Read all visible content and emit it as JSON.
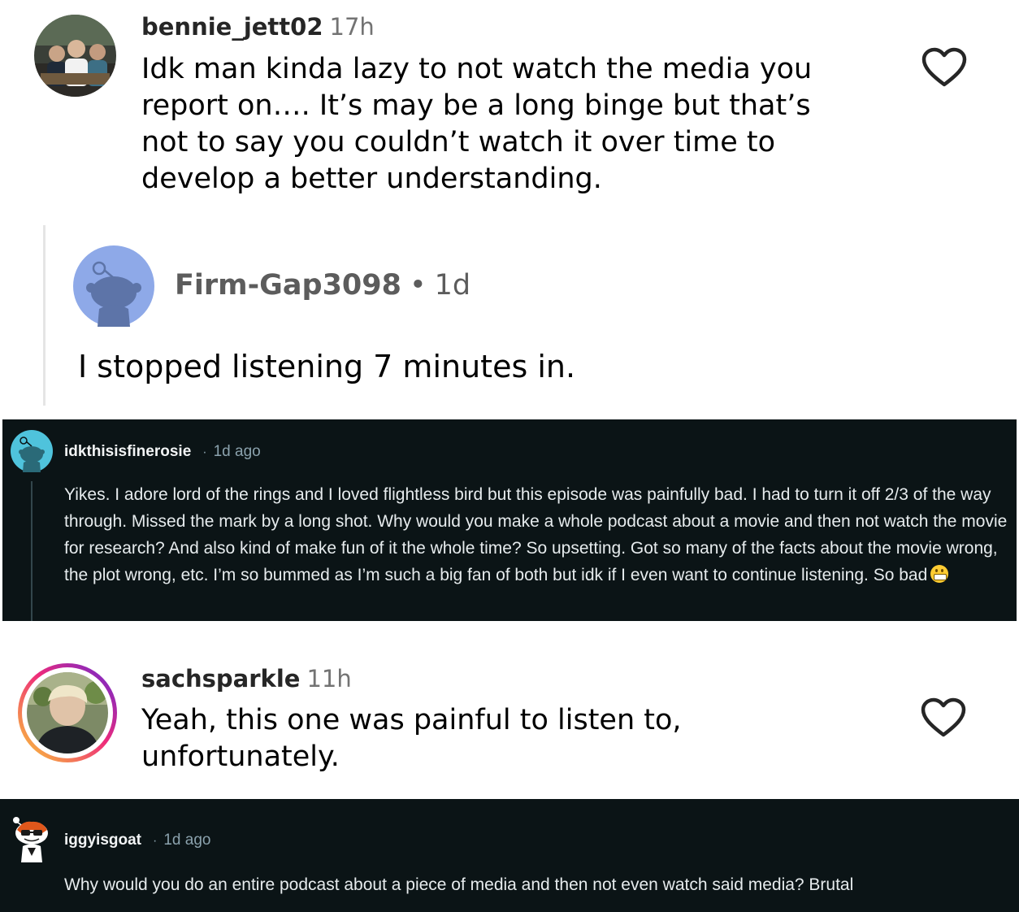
{
  "comments": {
    "bennie": {
      "username": "bennie_jett02",
      "time": "17h",
      "text": "Idk man kinda lazy to not watch the media you report on…. It’s may be a long binge but that’s not to say you couldn’t watch it over time to develop a better understanding."
    },
    "firmgap": {
      "username": "Firm-Gap3098",
      "separator": "•",
      "time": "1d",
      "text": "I stopped listening 7 minutes in."
    },
    "idkthisisfinerosie": {
      "username": "idkthisisfinerosie",
      "separator": "·",
      "time": "1d ago",
      "text": "Yikes. I adore lord of the rings and I loved flightless bird but this episode was painfully bad. I had to turn it off 2/3 of the way through. Missed the mark by a long shot. Why would you make a whole podcast about a movie and then not watch the movie for research? And also kind of make fun of it the whole time? So upsetting. Got so many of the facts about the movie wrong, the plot wrong, etc. I’m so bummed as I’m such a big fan of both but idk if I even want to continue listening. So bad",
      "emoji": "grimacing-face-emoji"
    },
    "sachsparkle": {
      "username": "sachsparkle",
      "time": "11h",
      "text": "Yeah, this one was painful to listen to, unfortunately."
    },
    "iggyisgoat": {
      "username": "iggyisgoat",
      "separator": "·",
      "time": "1d ago",
      "text": "Why would you do an entire podcast about a piece of media and then not even watch said media? Brutal"
    }
  },
  "icons": {
    "like": "heart-outline-icon",
    "default_avatar": "reddit-snoo-avatar"
  },
  "colors": {
    "dark_bg": "#0b1416",
    "snoo_blue": "#8ea9e8",
    "snoo_cyan": "#4fc3dc",
    "story_ring_start": "#f9ce34",
    "story_ring_mid": "#ee2a7b",
    "story_ring_end": "#6228d7"
  }
}
